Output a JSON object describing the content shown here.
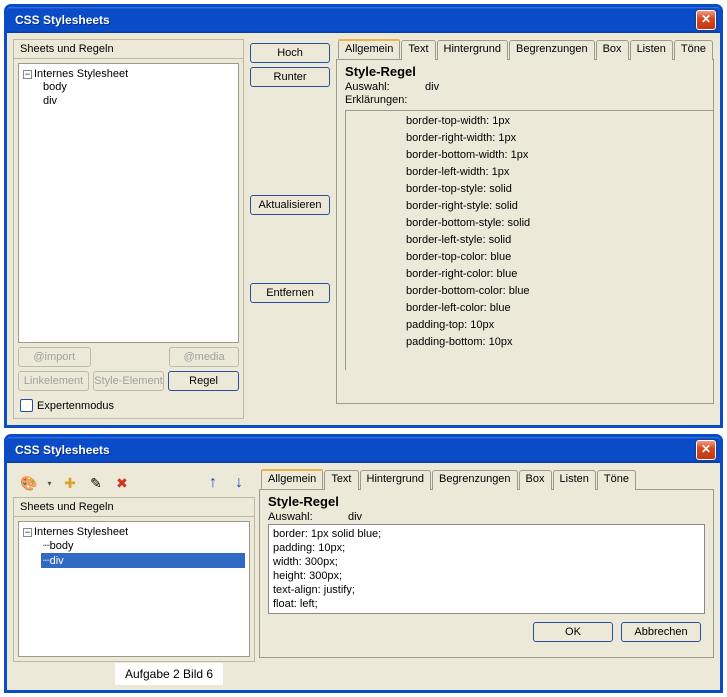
{
  "window1": {
    "title": "CSS Stylesheets",
    "left_panel_header": "Sheets und Regeln",
    "tree": {
      "root": "Internes Stylesheet",
      "items": [
        "body",
        "div"
      ],
      "selected": null
    },
    "mid_buttons": {
      "up": "Hoch",
      "down": "Runter",
      "refresh": "Aktualisieren",
      "remove": "Entfernen"
    },
    "bottom_buttons": {
      "import": "@import",
      "media": "@media",
      "link_element": "Linkelement",
      "style_element": "Style-Element",
      "rule": "Regel"
    },
    "expert_mode": "Expertenmodus",
    "tabs": [
      "Allgemein",
      "Text",
      "Hintergrund",
      "Begrenzungen",
      "Box",
      "Listen",
      "Töne"
    ],
    "active_tab": 0,
    "style_rule": {
      "heading": "Style-Regel",
      "selector_label": "Auswahl:",
      "selector_value": "div",
      "decl_label": "Erklärungen:",
      "declarations": [
        "border-top-width: 1px",
        "border-right-width: 1px",
        "border-bottom-width: 1px",
        "border-left-width: 1px",
        "border-top-style: solid",
        "border-right-style: solid",
        "border-bottom-style: solid",
        "border-left-style: solid",
        "border-top-color: blue",
        "border-right-color: blue",
        "border-bottom-color: blue",
        "border-left-color: blue",
        "padding-top: 10px",
        "padding-bottom: 10px"
      ]
    }
  },
  "window2": {
    "title": "CSS Stylesheets",
    "left_panel_header": "Sheets und Regeln",
    "tree": {
      "root": "Internes Stylesheet",
      "items": [
        "body",
        "div"
      ],
      "selected": "div"
    },
    "tabs": [
      "Allgemein",
      "Text",
      "Hintergrund",
      "Begrenzungen",
      "Box",
      "Listen",
      "Töne"
    ],
    "active_tab": 0,
    "style_rule": {
      "heading": "Style-Regel",
      "selector_label": "Auswahl:",
      "selector_value": "div",
      "css_lines": [
        "border: 1px solid blue;",
        "padding: 10px;",
        "width: 300px;",
        "height: 300px;",
        "text-align: justify;",
        "float: left;"
      ]
    },
    "footer": {
      "ok": "OK",
      "cancel": "Abbrechen"
    }
  },
  "caption": "Aufgabe 2 Bild 6"
}
